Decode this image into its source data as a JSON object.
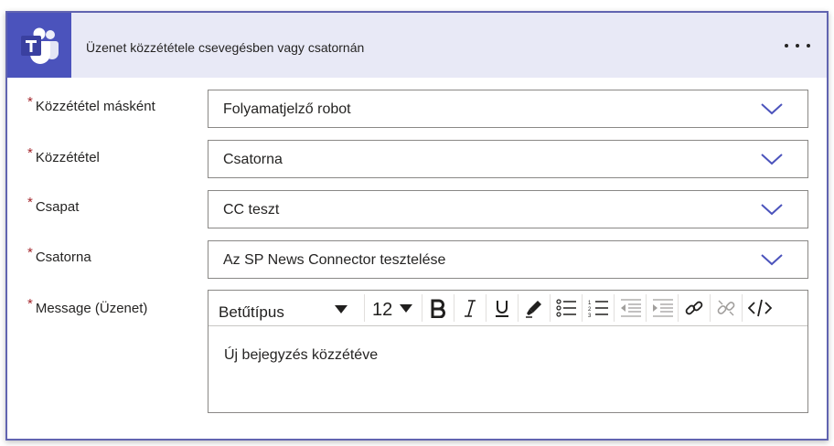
{
  "header": {
    "title": "Üzenet közzététele csevegésben vagy csatornán",
    "app_icon": "teams-icon",
    "more_icon": "more-ellipsis-icon"
  },
  "fields": [
    {
      "label": "Közzététel másként",
      "required": true,
      "value": "Folyamatjelző robot"
    },
    {
      "label": "Közzététel",
      "required": true,
      "value": "Csatorna"
    },
    {
      "label": "Csapat",
      "required": true,
      "value": "CC teszt"
    },
    {
      "label": "Csatorna",
      "required": true,
      "value": "Az SP News Connector tesztelése"
    }
  ],
  "message": {
    "label": "Message (Üzenet)",
    "required": true,
    "font_label": "Betűtípus",
    "size_label": "12",
    "body": "Új bejegyzés közzétéve",
    "toolbar_icons": [
      "bold-icon",
      "italic-icon",
      "underline-icon",
      "highlighter-icon",
      "bulleted-list-icon",
      "numbered-list-icon",
      "decrease-indent-icon",
      "increase-indent-icon",
      "link-icon",
      "unlink-icon",
      "code-view-icon"
    ]
  },
  "required_marker": "*",
  "colors": {
    "accent": "#4b53bc",
    "header_bg": "#e8e9f6",
    "required": "#a4262c",
    "chevron": "#4b53bc"
  }
}
